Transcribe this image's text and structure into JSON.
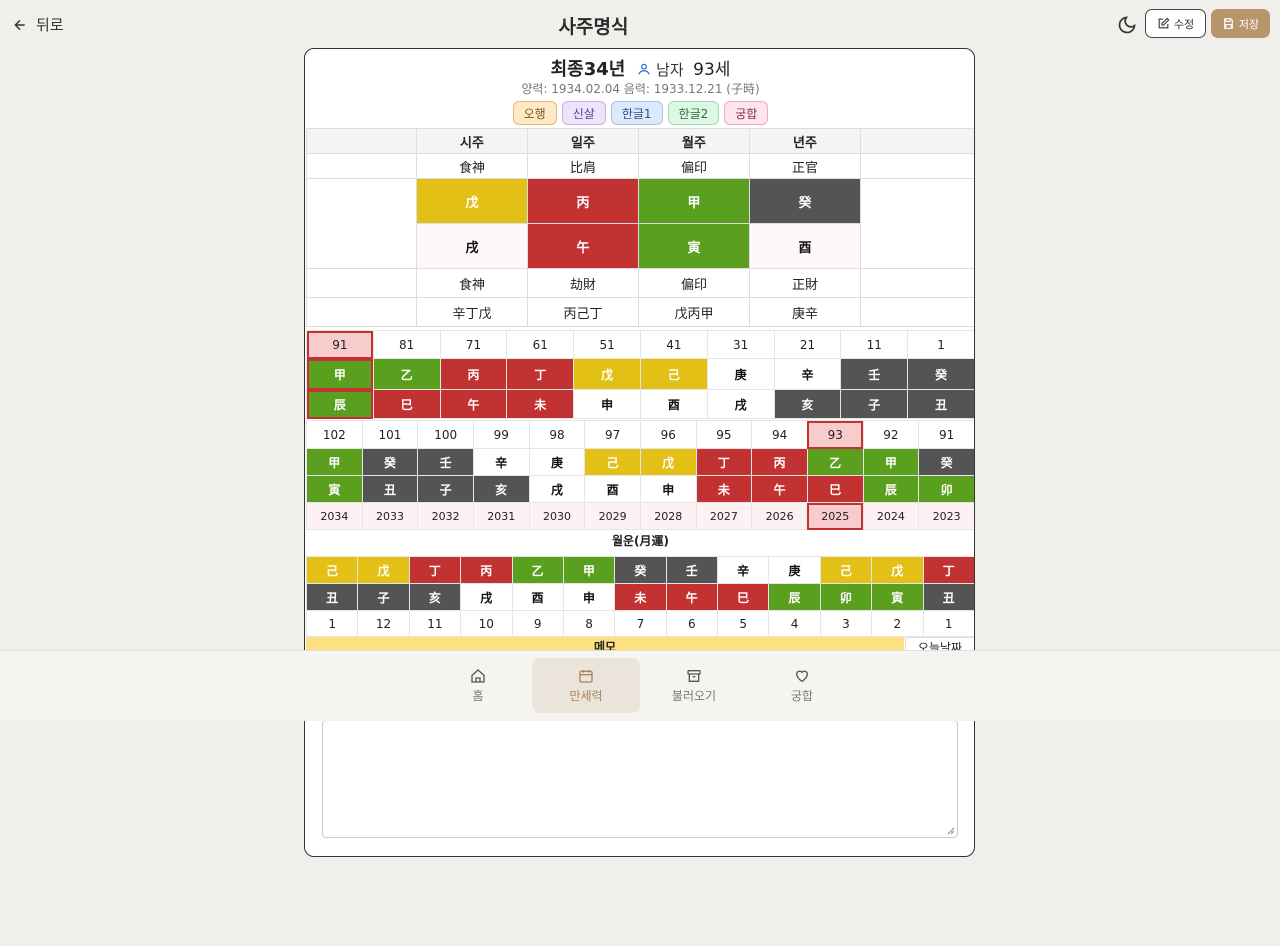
{
  "topbar": {
    "back_label": "뒤로",
    "title": "사주명식",
    "edit_label": "수정",
    "save_label": "저장"
  },
  "profile": {
    "name": "최종34년",
    "gender": "남자",
    "age": "93세",
    "dates": "양력: 1934.02.04 음력: 1933.12.21 (子時)"
  },
  "tabs": [
    {
      "label": "오행",
      "bg": "#fde9c8",
      "border": "#e8b872",
      "color": "#7a5a1a"
    },
    {
      "label": "신살",
      "bg": "#ede4fb",
      "border": "#c7b0ec",
      "color": "#5b3d8a"
    },
    {
      "label": "한글1",
      "bg": "#dce9fb",
      "border": "#a7c3ee",
      "color": "#2d4f86"
    },
    {
      "label": "한글2",
      "bg": "#def7e5",
      "border": "#9fdcb1",
      "color": "#2c6b3e"
    },
    {
      "label": "궁합",
      "bg": "#fde4ee",
      "border": "#f0aac6",
      "color": "#8a2c52"
    }
  ],
  "colors": {
    "yellow": "#e2c015",
    "red": "#c33232",
    "green": "#5a9f1e",
    "dark": "#545454",
    "white": "#ffffff",
    "pink": "#fff8f8",
    "highlight": "#f8cccc",
    "accent": "#b8956a"
  },
  "pillars": {
    "headers": [
      "시주",
      "일주",
      "월주",
      "년주"
    ],
    "top_gods": [
      "食神",
      "比肩",
      "偏印",
      "正官"
    ],
    "stems": [
      {
        "ch": "戊",
        "color": "yellow"
      },
      {
        "ch": "丙",
        "color": "red"
      },
      {
        "ch": "甲",
        "color": "green"
      },
      {
        "ch": "癸",
        "color": "dark"
      }
    ],
    "branches": [
      {
        "ch": "戌",
        "color": "pink"
      },
      {
        "ch": "午",
        "color": "red"
      },
      {
        "ch": "寅",
        "color": "green"
      },
      {
        "ch": "酉",
        "color": "pink"
      }
    ],
    "bottom_gods": [
      "食神",
      "劫財",
      "偏印",
      "正財"
    ],
    "hidden": [
      "辛丁戊",
      "丙己丁",
      "戊丙甲",
      "庚辛"
    ]
  },
  "daewoon": {
    "ages": [
      "91",
      "81",
      "71",
      "61",
      "51",
      "41",
      "31",
      "21",
      "11",
      "1"
    ],
    "stems": [
      {
        "ch": "甲",
        "color": "green"
      },
      {
        "ch": "乙",
        "color": "green"
      },
      {
        "ch": "丙",
        "color": "red"
      },
      {
        "ch": "丁",
        "color": "red"
      },
      {
        "ch": "戊",
        "color": "yellow"
      },
      {
        "ch": "己",
        "color": "yellow"
      },
      {
        "ch": "庚",
        "color": "white"
      },
      {
        "ch": "辛",
        "color": "white"
      },
      {
        "ch": "壬",
        "color": "dark"
      },
      {
        "ch": "癸",
        "color": "dark"
      }
    ],
    "branches": [
      {
        "ch": "辰",
        "color": "green"
      },
      {
        "ch": "巳",
        "color": "red"
      },
      {
        "ch": "午",
        "color": "red"
      },
      {
        "ch": "未",
        "color": "red"
      },
      {
        "ch": "申",
        "color": "white"
      },
      {
        "ch": "酉",
        "color": "white"
      },
      {
        "ch": "戌",
        "color": "white"
      },
      {
        "ch": "亥",
        "color": "dark"
      },
      {
        "ch": "子",
        "color": "dark"
      },
      {
        "ch": "丑",
        "color": "dark"
      }
    ],
    "selected_index": 0
  },
  "sewoon": {
    "ages": [
      "102",
      "101",
      "100",
      "99",
      "98",
      "97",
      "96",
      "95",
      "94",
      "93",
      "92",
      "91"
    ],
    "stems": [
      {
        "ch": "甲",
        "color": "green"
      },
      {
        "ch": "癸",
        "color": "dark"
      },
      {
        "ch": "壬",
        "color": "dark"
      },
      {
        "ch": "辛",
        "color": "white"
      },
      {
        "ch": "庚",
        "color": "white"
      },
      {
        "ch": "己",
        "color": "yellow"
      },
      {
        "ch": "戊",
        "color": "yellow"
      },
      {
        "ch": "丁",
        "color": "red"
      },
      {
        "ch": "丙",
        "color": "red"
      },
      {
        "ch": "乙",
        "color": "green"
      },
      {
        "ch": "甲",
        "color": "green"
      },
      {
        "ch": "癸",
        "color": "dark"
      }
    ],
    "branches": [
      {
        "ch": "寅",
        "color": "green"
      },
      {
        "ch": "丑",
        "color": "dark"
      },
      {
        "ch": "子",
        "color": "dark"
      },
      {
        "ch": "亥",
        "color": "dark"
      },
      {
        "ch": "戌",
        "color": "white"
      },
      {
        "ch": "酉",
        "color": "white"
      },
      {
        "ch": "申",
        "color": "white"
      },
      {
        "ch": "未",
        "color": "red"
      },
      {
        "ch": "午",
        "color": "red"
      },
      {
        "ch": "巳",
        "color": "red"
      },
      {
        "ch": "辰",
        "color": "green"
      },
      {
        "ch": "卯",
        "color": "green"
      }
    ],
    "years": [
      "2034",
      "2033",
      "2032",
      "2031",
      "2030",
      "2029",
      "2028",
      "2027",
      "2026",
      "2025",
      "2024",
      "2023"
    ],
    "selected_index": 9
  },
  "wolwoon": {
    "title": "월운(月運)",
    "stems": [
      {
        "ch": "己",
        "color": "yellow"
      },
      {
        "ch": "戊",
        "color": "yellow"
      },
      {
        "ch": "丁",
        "color": "red"
      },
      {
        "ch": "丙",
        "color": "red"
      },
      {
        "ch": "乙",
        "color": "green"
      },
      {
        "ch": "甲",
        "color": "green"
      },
      {
        "ch": "癸",
        "color": "dark"
      },
      {
        "ch": "壬",
        "color": "dark"
      },
      {
        "ch": "辛",
        "color": "white"
      },
      {
        "ch": "庚",
        "color": "white"
      },
      {
        "ch": "己",
        "color": "yellow"
      },
      {
        "ch": "戊",
        "color": "yellow"
      },
      {
        "ch": "丁",
        "color": "red"
      }
    ],
    "branches": [
      {
        "ch": "丑",
        "color": "dark"
      },
      {
        "ch": "子",
        "color": "dark"
      },
      {
        "ch": "亥",
        "color": "dark"
      },
      {
        "ch": "戌",
        "color": "white"
      },
      {
        "ch": "酉",
        "color": "white"
      },
      {
        "ch": "申",
        "color": "white"
      },
      {
        "ch": "未",
        "color": "red"
      },
      {
        "ch": "午",
        "color": "red"
      },
      {
        "ch": "巳",
        "color": "red"
      },
      {
        "ch": "辰",
        "color": "green"
      },
      {
        "ch": "卯",
        "color": "green"
      },
      {
        "ch": "寅",
        "color": "green"
      },
      {
        "ch": "丑",
        "color": "dark"
      }
    ],
    "months": [
      "1",
      "12",
      "11",
      "10",
      "9",
      "8",
      "7",
      "6",
      "5",
      "4",
      "3",
      "2",
      "1"
    ]
  },
  "memo": {
    "label": "메모",
    "today_label": "오늘날짜"
  },
  "bottom_nav": [
    {
      "label": "홈",
      "icon": "home-icon",
      "active": false
    },
    {
      "label": "만세력",
      "icon": "calendar-icon",
      "active": true
    },
    {
      "label": "불러오기",
      "icon": "archive-icon",
      "active": false
    },
    {
      "label": "궁합",
      "icon": "heart-icon",
      "active": false
    }
  ]
}
